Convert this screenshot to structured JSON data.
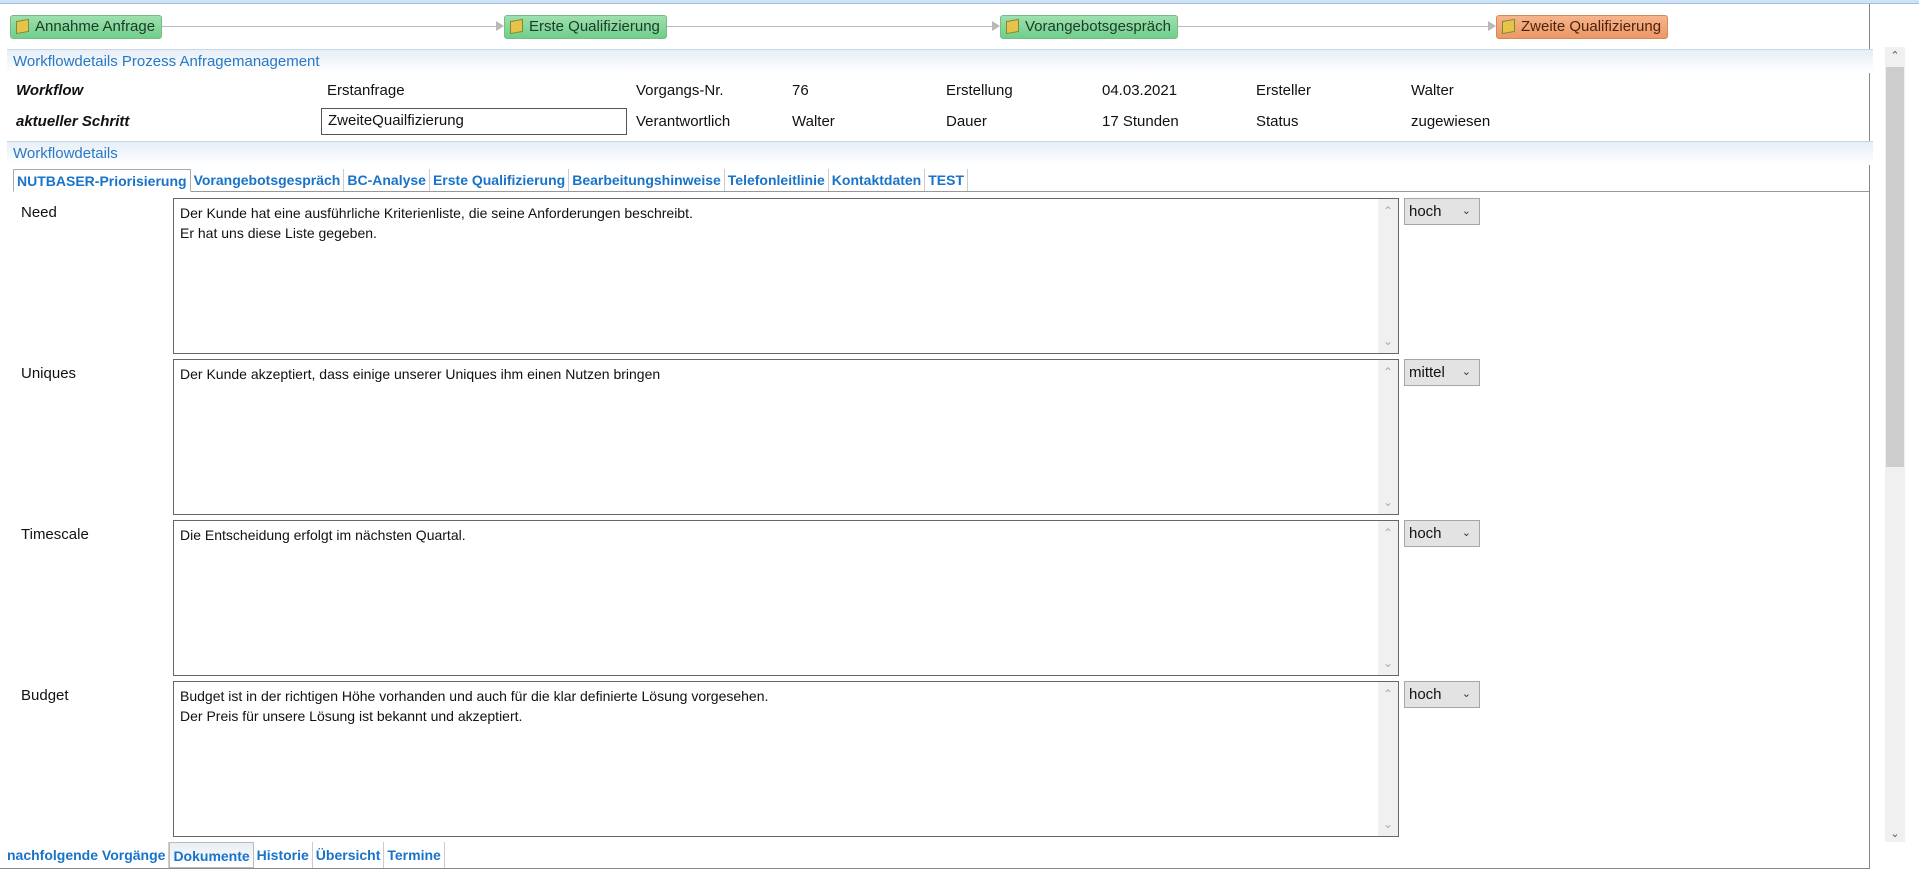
{
  "workflow_steps": [
    {
      "label": "Annahme Anfrage",
      "state": "done"
    },
    {
      "label": "Erste Qualifizierung",
      "state": "done"
    },
    {
      "label": "Vorangebotsgespräch",
      "state": "done"
    },
    {
      "label": "Zweite Qualifizierung",
      "state": "active"
    }
  ],
  "process_section": {
    "title": "Workflowdetails Prozess Anfragemanagement",
    "workflow_label": "Workflow",
    "workflow_value": "Erstanfrage",
    "step_label": "aktueller Schritt",
    "step_value": "ZweiteQuailfizierung",
    "case_no_label": "Vorgangs-Nr.",
    "case_no_value": "76",
    "responsible_label": "Verantwortlich",
    "responsible_value": "Walter",
    "created_label": "Erstellung",
    "created_value": "04.03.2021",
    "duration_label": "Dauer",
    "duration_value": "17 Stunden",
    "creator_label": "Ersteller",
    "creator_value": "Walter",
    "status_label": "Status",
    "status_value": "zugewiesen"
  },
  "details_section": {
    "title": "Workflowdetails"
  },
  "tabs": [
    "NUTBASER-Priorisierung",
    "Vorangebotsgespräch",
    "BC-Analyse",
    "Erste Qualifizierung",
    "Bearbeitungshinweise",
    "Telefonleitlinie",
    "Kontaktdaten",
    "TEST"
  ],
  "fields": [
    {
      "label": "Need",
      "text": "Der Kunde hat eine ausführliche Kriterienliste, die seine Anforderungen beschreibt.\nEr hat uns diese Liste gegeben.",
      "rating": "hoch"
    },
    {
      "label": "Uniques",
      "text": "Der Kunde akzeptiert, dass einige unserer Uniques ihm einen Nutzen bringen",
      "rating": "mittel"
    },
    {
      "label": "Timescale",
      "text": "Die Entscheidung erfolgt im nächsten Quartal.",
      "rating": "hoch"
    },
    {
      "label": "Budget",
      "text": "Budget ist in der richtigen Höhe vorhanden und auch für die klar definierte Lösung vorgesehen.\nDer Preis für unsere Lösung ist bekannt und akzeptiert.",
      "rating": "hoch"
    }
  ],
  "bottom_tabs": [
    "nachfolgende Vorgänge",
    "Dokumente",
    "Historie",
    "Übersicht",
    "Termine"
  ]
}
